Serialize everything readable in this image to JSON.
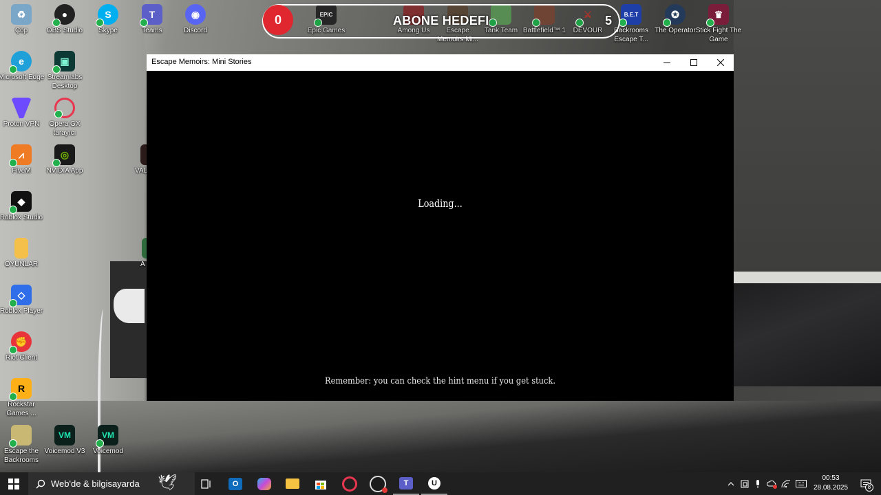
{
  "desktop": {
    "icons_left": [
      {
        "label": "Çöp",
        "icon": "recycle-bin-icon"
      },
      {
        "label": "OBS Studio",
        "icon": "obs-icon"
      },
      {
        "label": "Skype",
        "icon": "skype-icon"
      },
      {
        "label": "Teams",
        "icon": "teams-icon"
      },
      {
        "label": "Discord",
        "icon": "discord-icon"
      },
      {
        "label": "Microsoft Edge",
        "icon": "edge-icon"
      },
      {
        "label": "Streamlabs Desktop",
        "icon": "streamlabs-icon"
      },
      {
        "label": "Proton VPN",
        "icon": "protonvpn-icon"
      },
      {
        "label": "Opera GX tarayıcı",
        "icon": "operagx-icon"
      },
      {
        "label": "FiveM",
        "icon": "fivem-icon"
      },
      {
        "label": "NVIDIA App",
        "icon": "nvidia-icon"
      },
      {
        "label": "VAL",
        "icon": "valorant-icon"
      },
      {
        "label": "Roblox Studio",
        "icon": "roblox-studio-icon"
      },
      {
        "label": "OYUNLAR",
        "icon": "folder-icon"
      },
      {
        "label": "A",
        "icon": "app-icon"
      },
      {
        "label": "Roblox Player",
        "icon": "roblox-player-icon"
      },
      {
        "label": "Riot Client",
        "icon": "riot-icon"
      },
      {
        "label": "Rockstar Games ...",
        "icon": "rockstar-icon"
      },
      {
        "label": "Escape the Backrooms",
        "icon": "escape-backrooms-icon"
      },
      {
        "label": "Voicemod V3",
        "icon": "voicemod-v3-icon"
      },
      {
        "label": "Voicemod",
        "icon": "voicemod-icon"
      }
    ],
    "icons_top": [
      {
        "label": "Epic Games",
        "icon": "epic-games-icon"
      },
      {
        "label": "Among Us",
        "icon": "among-us-icon"
      },
      {
        "label": "Escape Memoirs Mi...",
        "icon": "escape-memoirs-icon"
      },
      {
        "label": "Tank Team",
        "icon": "tank-team-icon"
      },
      {
        "label": "Battlefield™ 1",
        "icon": "battlefield-icon"
      },
      {
        "label": "DEVOUR",
        "icon": "devour-icon"
      },
      {
        "label": "Backrooms Escape T...",
        "icon": "backrooms-escape-icon"
      },
      {
        "label": "The Operator",
        "icon": "the-operator-icon"
      },
      {
        "label": "Stick Fight The Game",
        "icon": "stick-fight-icon"
      }
    ]
  },
  "subscriber_goal": {
    "current": "0",
    "label": "ABONE HEDEFI",
    "target": "5",
    "accent": "#e0262e"
  },
  "window": {
    "title": "Escape Memoirs: Mini Stories",
    "loading_text": "Loading...",
    "hint_text": "Remember: you can check the hint menu if you get stuck."
  },
  "taskbar": {
    "search_placeholder": "Web'de & bilgisayarda",
    "pinned": [
      "task-view-icon",
      "outlook-icon",
      "copilot-icon",
      "file-explorer-icon",
      "microsoft-store-icon",
      "opera-gx-icon",
      "obs-icon",
      "teams-icon",
      "unreal-engine-icon"
    ],
    "time": "00:53",
    "date": "28.08.2025",
    "notification_count": "8"
  }
}
